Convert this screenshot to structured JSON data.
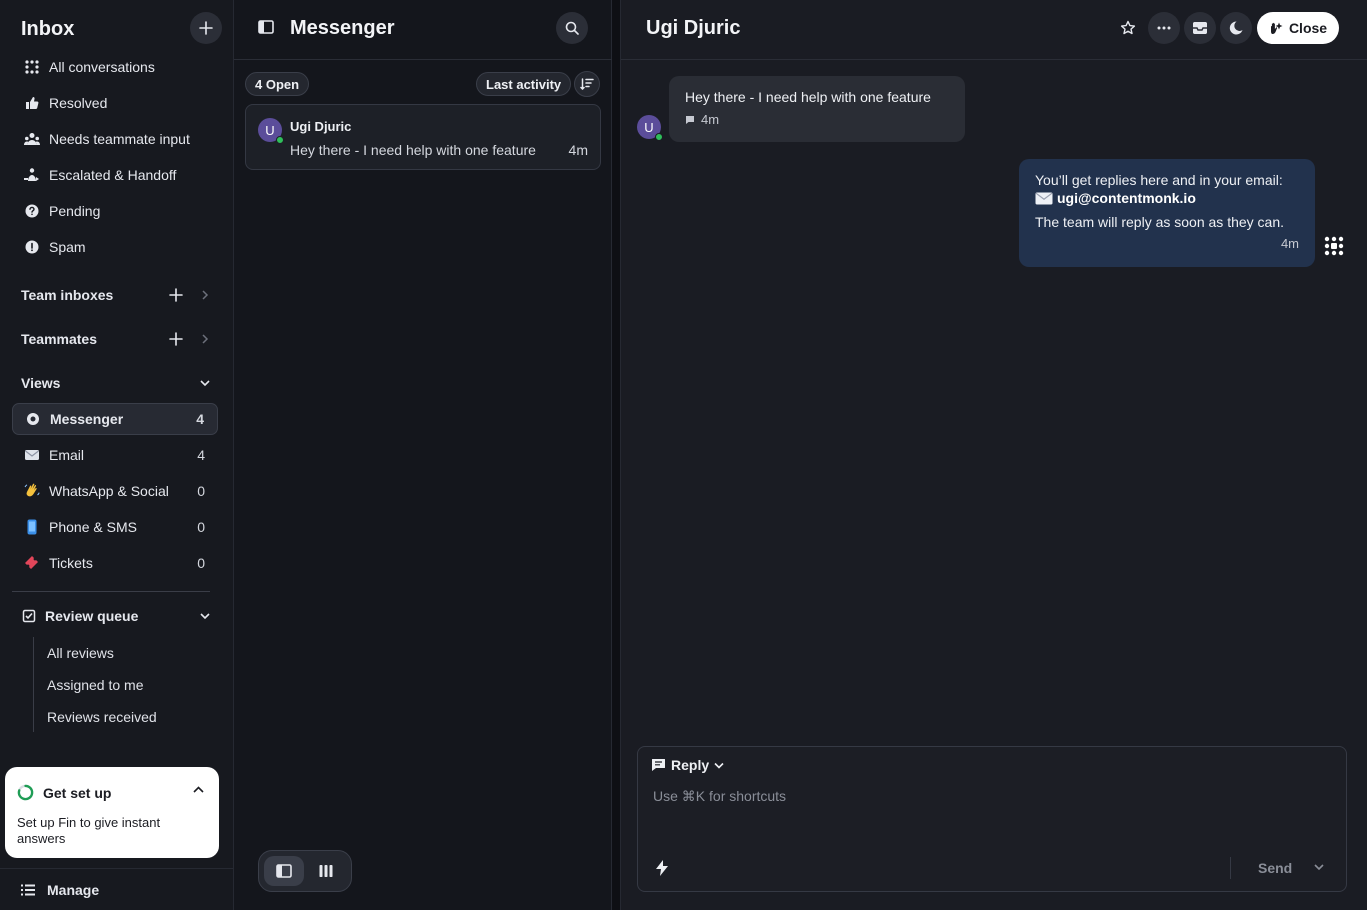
{
  "sidebar": {
    "title": "Inbox",
    "nav": [
      {
        "label": "All conversations",
        "icon": "grid-icon"
      },
      {
        "label": "Resolved",
        "icon": "thumbs-up-icon"
      },
      {
        "label": "Needs teammate input",
        "icon": "people-icon"
      },
      {
        "label": "Escalated & Handoff",
        "icon": "handoff-icon"
      },
      {
        "label": "Pending",
        "icon": "question-icon"
      },
      {
        "label": "Spam",
        "icon": "alert-icon"
      }
    ],
    "team_inboxes": "Team inboxes",
    "teammates": "Teammates",
    "views_title": "Views",
    "views": [
      {
        "label": "Messenger",
        "count": "4",
        "icon": "messenger-icon"
      },
      {
        "label": "Email",
        "count": "4",
        "icon": "envelope-emoji"
      },
      {
        "label": "WhatsApp & Social",
        "count": "0",
        "icon": "waving-hand-emoji"
      },
      {
        "label": "Phone & SMS",
        "count": "0",
        "icon": "phone-emoji"
      },
      {
        "label": "Tickets",
        "count": "0",
        "icon": "ticket-emoji"
      }
    ],
    "review_queue": {
      "title": "Review queue",
      "items": [
        "All reviews",
        "Assigned to me",
        "Reviews received"
      ]
    },
    "setup": {
      "title": "Get set up",
      "description": "Set up Fin to give instant answers"
    },
    "manage": "Manage"
  },
  "list": {
    "title": "Messenger",
    "open_count": "4 Open",
    "sort_label": "Last activity",
    "conversations": [
      {
        "initial": "U",
        "name": "Ugi Djuric",
        "preview": "Hey there - I need help with one feature",
        "time": "4m"
      }
    ]
  },
  "conversation": {
    "title": "Ugi Djuric",
    "close_label": "Close",
    "incoming": {
      "avatar": "U",
      "text": "Hey there - I need help with one feature",
      "time": "4m"
    },
    "outgoing": {
      "line1": "You’ll get replies here and in your email:",
      "email": "ugi@contentmonk.io",
      "line3": "The team will reply as soon as they can.",
      "time": "4m"
    },
    "composer": {
      "mode": "Reply",
      "placeholder": "Use ⌘K for shortcuts",
      "send": "Send"
    }
  },
  "colors": {
    "background": "#14161c",
    "outgoing_bubble": "#22324d",
    "online": "#2fbf5b",
    "avatar": "#5b4d9a"
  }
}
